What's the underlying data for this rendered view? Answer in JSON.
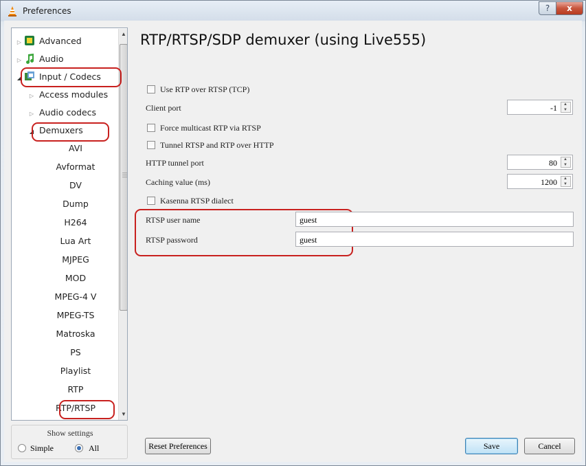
{
  "window": {
    "title": "Preferences",
    "help_glyph": "?",
    "close_glyph": "x",
    "icons": {
      "app": "vlc-cone-icon"
    }
  },
  "tree": {
    "items": [
      {
        "label": "Advanced",
        "icon": "chip-icon",
        "expand": "closed"
      },
      {
        "label": "Audio",
        "icon": "music-note-icon",
        "expand": "closed"
      },
      {
        "label": "Input / Codecs",
        "icon": "codec-icon",
        "expand": "open"
      },
      {
        "label": "Access modules",
        "expand": "closed"
      },
      {
        "label": "Audio codecs",
        "expand": "closed"
      },
      {
        "label": "Demuxers",
        "expand": "open"
      },
      {
        "label": "AVI"
      },
      {
        "label": "Avformat"
      },
      {
        "label": "DV"
      },
      {
        "label": "Dump"
      },
      {
        "label": "H264"
      },
      {
        "label": "Lua Art"
      },
      {
        "label": "MJPEG"
      },
      {
        "label": "MOD"
      },
      {
        "label": "MPEG-4 V"
      },
      {
        "label": "MPEG-TS"
      },
      {
        "label": "Matroska"
      },
      {
        "label": "PS"
      },
      {
        "label": "Playlist"
      },
      {
        "label": "RTP"
      },
      {
        "label": "RTP/RTSP",
        "selected": true
      }
    ]
  },
  "show_settings": {
    "label": "Show settings",
    "options": [
      "Simple",
      "All"
    ],
    "selected": "All"
  },
  "panel": {
    "title": "RTP/RTSP/SDP demuxer (using Live555)",
    "use_rtp_over_rtsp": {
      "label": "Use RTP over RTSP (TCP)",
      "checked": false
    },
    "client_port": {
      "label": "Client port",
      "value": "-1"
    },
    "force_multicast": {
      "label": "Force multicast RTP via RTSP",
      "checked": false
    },
    "tunnel_rtsp": {
      "label": "Tunnel RTSP and RTP over HTTP",
      "checked": false
    },
    "http_tunnel_port": {
      "label": "HTTP tunnel port",
      "value": "80"
    },
    "caching": {
      "label": "Caching value (ms)",
      "value": "1200"
    },
    "kasenna": {
      "label": "Kasenna RTSP dialect",
      "checked": false
    },
    "user_name": {
      "label": "RTSP user name",
      "value": "guest"
    },
    "password": {
      "label": "RTSP password",
      "value": "guest"
    }
  },
  "buttons": {
    "reset": "Reset Preferences",
    "save": "Save",
    "cancel": "Cancel"
  },
  "colors": {
    "highlight_annotation": "#c8201e",
    "default_button": "#bfe2f6"
  }
}
